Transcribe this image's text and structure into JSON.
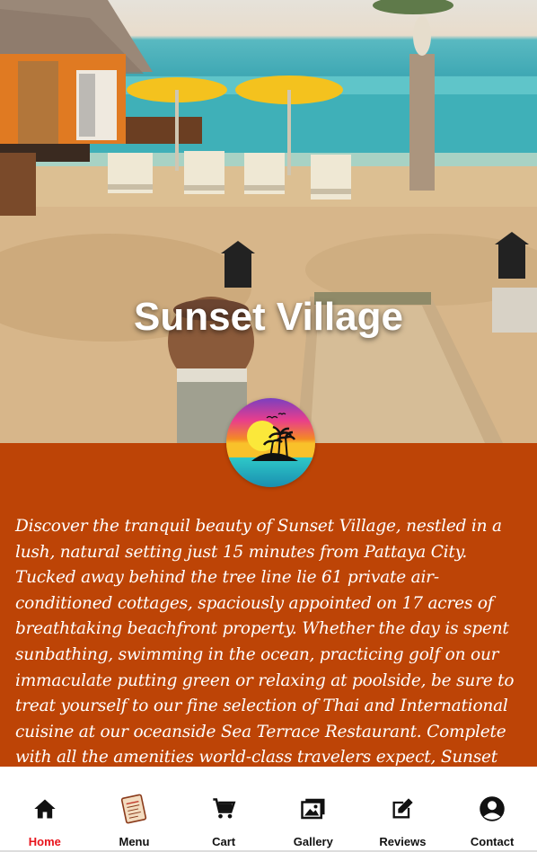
{
  "hero": {
    "title": "Sunset Village"
  },
  "logo": {
    "icon": "sunset-island-logo"
  },
  "description": {
    "text": "Discover the tranquil beauty of Sunset Village, nestled in a lush, natural setting just 15 minutes from Pattaya City. Tucked away behind the tree line lie 61 private air-conditioned cottages, spaciously appointed on 17 acres of breathtaking beachfront property.  Whether the day is spent sunbathing, swimming in the ocean, practicing golf on our immaculate putting green or relaxing at poolside, be sure to treat yourself to our fine selection of Thai and International cuisine at our oceanside Sea Terrace Restaurant. Complete with all the amenities world-class travelers expect, Sunset"
  },
  "nav": {
    "items": [
      {
        "label": "Home",
        "icon": "home-icon",
        "active": true
      },
      {
        "label": "Menu",
        "icon": "menu-book-icon",
        "active": false
      },
      {
        "label": "Cart",
        "icon": "cart-icon",
        "active": false
      },
      {
        "label": "Gallery",
        "icon": "gallery-icon",
        "active": false
      },
      {
        "label": "Reviews",
        "icon": "reviews-icon",
        "active": false
      },
      {
        "label": "Contact",
        "icon": "contact-icon",
        "active": false
      }
    ]
  },
  "colors": {
    "panel_bg": "#bd4406",
    "active_nav": "#e8141c"
  }
}
